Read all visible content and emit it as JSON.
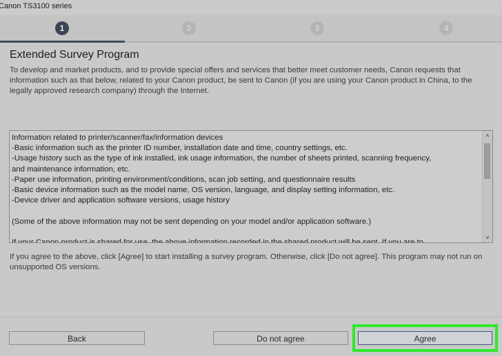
{
  "window": {
    "title": "Canon TS3100 series"
  },
  "steps": [
    {
      "number": "1",
      "state": "active"
    },
    {
      "number": "2",
      "state": "inactive"
    },
    {
      "number": "3",
      "state": "inactive"
    },
    {
      "number": "4",
      "state": "inactive"
    }
  ],
  "colors": {
    "highlight": "#2ee82e",
    "active_step": "#3b4454"
  },
  "page": {
    "heading": "Extended Survey Program",
    "intro": "To develop and market products, and to provide special offers and services that better meet customer needs, Canon requests that information such as that below, related to your Canon product, be sent to Canon (if you are using your Canon product in China, to the legally approved research company) through the Internet.",
    "textbox_lines": [
      "Information related to printer/scanner/fax/information devices",
      "-Basic information such as the printer ID number, installation date and time, country settings, etc.",
      "-Usage history such as the type of ink installed, ink usage information, the number of sheets printed, scanning frequency,",
      "and maintenance information, etc.",
      "-Paper use information, printing environment/conditions, scan job setting, and questionnaire results",
      "-Basic device information such as the model name, OS version, language, and display setting information, etc.",
      "-Device driver and application software versions, usage history",
      "",
      "(Some of the above information may not be sent depending on your model and/or application software.)",
      "",
      "If your Canon product is shared for use, the above information recorded in the shared product will be sent. If you are to"
    ],
    "agree_note": "If you agree to the above, click [Agree] to start installing a survey program. Otherwise, click [Do not agree]. This program may not run on unsupported OS versions."
  },
  "buttons": {
    "back": "Back",
    "disagree": "Do not agree",
    "agree": "Agree"
  },
  "icons": {
    "scroll_up": "chevron-up-icon",
    "scroll_down": "chevron-down-icon"
  }
}
